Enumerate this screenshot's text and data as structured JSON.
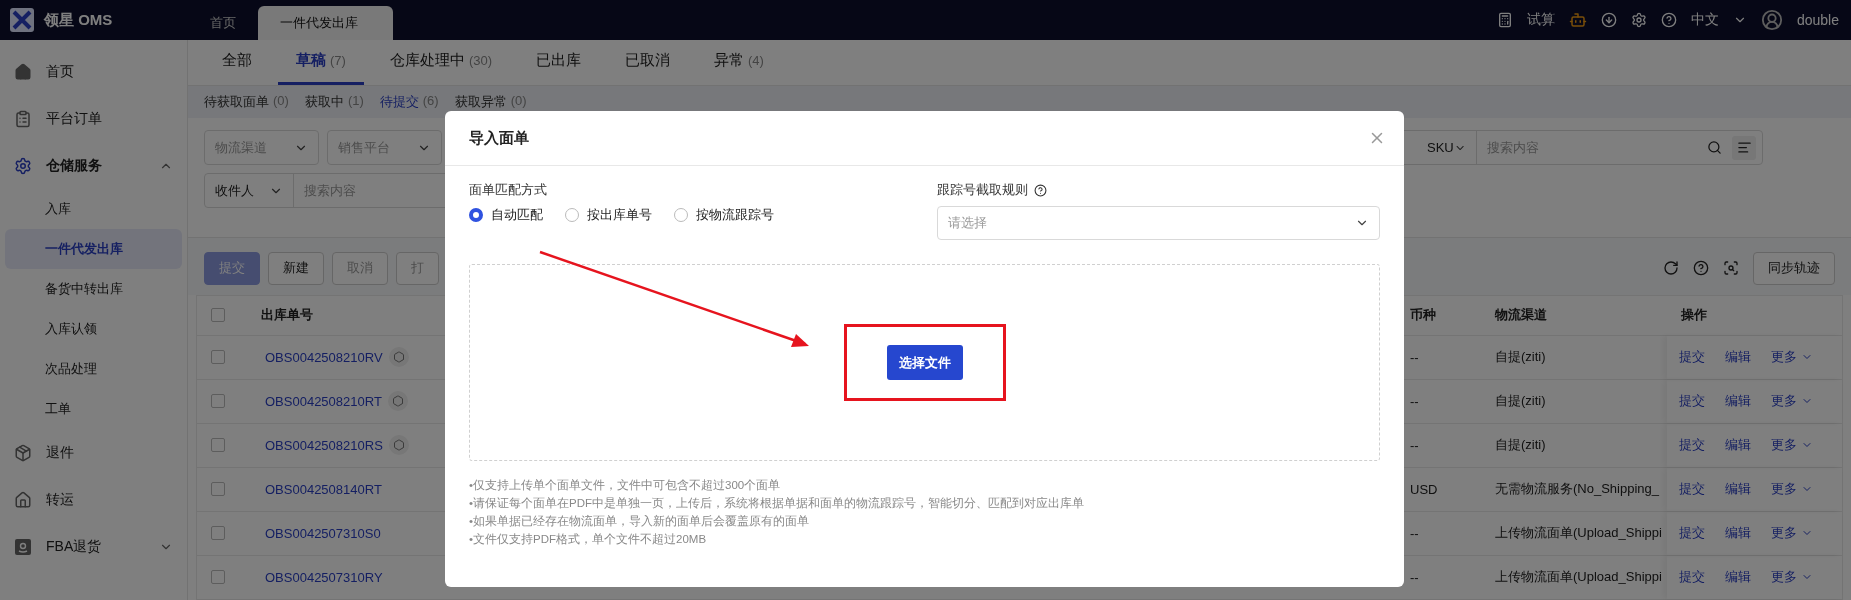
{
  "top_bar": {
    "brand": "领星 OMS",
    "tabs": [
      {
        "label": "首页",
        "selected": false
      },
      {
        "label": "一件代发出库",
        "selected": true
      }
    ],
    "trial": "试算",
    "language": "中文",
    "user": "double"
  },
  "sidebar": {
    "items": [
      {
        "label": "首页",
        "selected": false
      },
      {
        "label": "平台订单",
        "selected": false
      },
      {
        "label": "仓储服务",
        "selected": true,
        "expanded": true,
        "children": [
          {
            "label": "入库",
            "selected": false
          },
          {
            "label": "一件代发出库",
            "selected": true
          },
          {
            "label": "备货中转出库",
            "selected": false
          },
          {
            "label": "入库认领",
            "selected": false
          },
          {
            "label": "次品处理",
            "selected": false
          },
          {
            "label": "工单",
            "selected": false
          }
        ]
      },
      {
        "label": "退件",
        "selected": false
      },
      {
        "label": "转运",
        "selected": false
      },
      {
        "label": "FBA退货",
        "selected": false,
        "expanded": false
      }
    ]
  },
  "tabs": [
    {
      "label": "全部",
      "selected": false
    },
    {
      "label": "草稿",
      "count": "(7)",
      "selected": true
    },
    {
      "label": "仓库处理中",
      "count": "(30)",
      "selected": false
    },
    {
      "label": "已出库",
      "selected": false
    },
    {
      "label": "已取消",
      "selected": false
    },
    {
      "label": "异常",
      "count": "(4)",
      "selected": false
    }
  ],
  "sub_tabs": [
    {
      "label": "待获取面单",
      "count": "(0)",
      "selected": false
    },
    {
      "label": "获取中",
      "count": "(1)",
      "selected": false
    },
    {
      "label": "待提交",
      "count": "(6)",
      "selected": true
    },
    {
      "label": "获取异常",
      "count": "(0)",
      "selected": false
    }
  ],
  "filters": {
    "selects": [
      "物流渠道",
      "销售平台"
    ],
    "sku_search": {
      "field": "SKU",
      "placeholder": "搜索内容"
    },
    "recipient_search": {
      "field": "收件人",
      "placeholder": "搜索内容"
    }
  },
  "toolbar": {
    "buttons": [
      {
        "label": "提交",
        "disabled": true,
        "kind": "primary"
      },
      {
        "label": "新建",
        "disabled": false,
        "kind": "default"
      },
      {
        "label": "取消",
        "disabled": true,
        "kind": "default"
      },
      {
        "label": "打",
        "disabled": true,
        "kind": "default"
      }
    ],
    "sync": "同步轨迹"
  },
  "table": {
    "columns": [
      "出库单号",
      "币种",
      "物流渠道",
      "操作"
    ],
    "all_checked": false,
    "rows": [
      {
        "checked": false,
        "order": "OBS0042508210RV",
        "badge": true,
        "currency": "--",
        "channel": "自提(ziti)",
        "actions": [
          "提交",
          "编辑",
          "更多"
        ]
      },
      {
        "checked": false,
        "order": "OBS0042508210RT",
        "badge": true,
        "currency": "--",
        "channel": "自提(ziti)",
        "actions": [
          "提交",
          "编辑",
          "更多"
        ]
      },
      {
        "checked": false,
        "order": "OBS0042508210RS",
        "badge": true,
        "currency": "--",
        "channel": "自提(ziti)",
        "actions": [
          "提交",
          "编辑",
          "更多"
        ]
      },
      {
        "checked": false,
        "order": "OBS0042508140RT",
        "badge": false,
        "currency": "USD",
        "channel": "无需物流服务(No_Shipping_",
        "actions": [
          "提交",
          "编辑",
          "更多"
        ]
      },
      {
        "checked": false,
        "order": "OBS0042507310S0",
        "badge": false,
        "currency": "--",
        "channel": "上传物流面单(Upload_Shippi",
        "actions": [
          "提交",
          "编辑",
          "更多"
        ]
      },
      {
        "checked": false,
        "order": "OBS0042507310RY",
        "badge": false,
        "currency": "--",
        "channel": "上传物流面单(Upload_Shippi",
        "actions": [
          "提交",
          "编辑",
          "更多"
        ]
      }
    ]
  },
  "modal": {
    "title": "导入面单",
    "match_label": "面单匹配方式",
    "match_options": [
      {
        "label": "自动匹配",
        "selected": true
      },
      {
        "label": "按出库单号",
        "selected": false
      },
      {
        "label": "按物流跟踪号",
        "selected": false
      }
    ],
    "rule_label": "跟踪号截取规则",
    "rule_placeholder": "请选择",
    "upload_button": "选择文件",
    "notes": [
      "•仅支持上传单个面单文件，文件中可包含不超过300个面单",
      "•请保证每个面单在PDF中是单独一页，上传后，系统将根据单据和面单的物流跟踪号，智能切分、匹配到对应出库单",
      "•如果单据已经存在物流面单，导入新的面单后会覆盖原有的面单",
      "•文件仅支持PDF格式，单个文件不超过20MB"
    ]
  }
}
